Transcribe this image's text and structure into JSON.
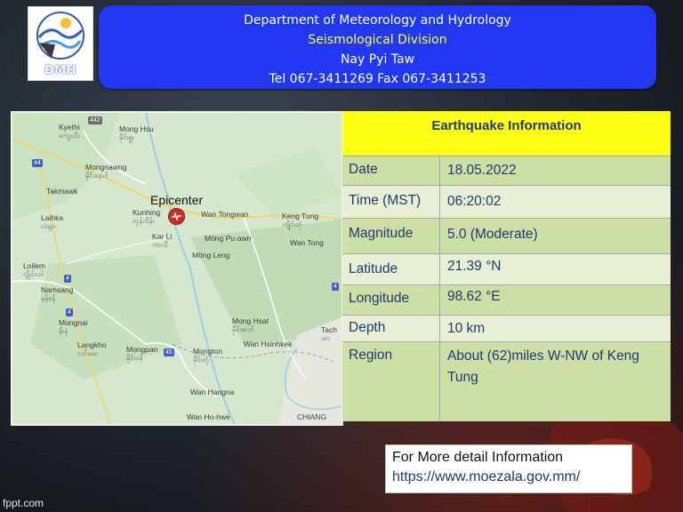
{
  "header": {
    "logo_text": "DMH",
    "line1": "Department of Meteorology and Hydrology",
    "line2": "Seismological Division",
    "line3": "Nay Pyi Taw",
    "line4": "Tel 067-3411269 Fax 067-3411253"
  },
  "map": {
    "epicenter_label": "Epicenter",
    "places": [
      {
        "name": "Kyethi",
        "sub": "ကျေးသီး"
      },
      {
        "name": "Mong Hsu",
        "sub": "မိုင်းရှူး"
      },
      {
        "name": "Mongnawng",
        "sub": "မိုင်းနောင်"
      },
      {
        "name": "Takmawk",
        "sub": ""
      },
      {
        "name": "Laihka",
        "sub": "လဲချား"
      },
      {
        "name": "Kunhing",
        "sub": "ကွန်ဟိန်း"
      },
      {
        "name": "Wan Tongwan",
        "sub": ""
      },
      {
        "name": "Keng Tung",
        "sub": "ကျိုင်းတုံ"
      },
      {
        "name": "Kar Li",
        "sub": "ကာလိ"
      },
      {
        "name": "Möng Pu-awn",
        "sub": ""
      },
      {
        "name": "Wan Tong",
        "sub": ""
      },
      {
        "name": "Möng Leng",
        "sub": ""
      },
      {
        "name": "Loilem",
        "sub": "လွိုင်လင်"
      },
      {
        "name": "Namsang",
        "sub": "နမ့်စန်"
      },
      {
        "name": "Mongnai",
        "sub": "မိုးနဲ"
      },
      {
        "name": "Mong Hsat",
        "sub": "မိုင်းဆတ်"
      },
      {
        "name": "Tach",
        "sub": "ထာ"
      },
      {
        "name": "Langkho",
        "sub": "လင်းခေး"
      },
      {
        "name": "Mongpan",
        "sub": "မိုင်းပန်"
      },
      {
        "name": "Mongton",
        "sub": "မိုင်းတုံ"
      },
      {
        "name": "Wan Hsinhkek",
        "sub": ""
      },
      {
        "name": "Wan Hangna",
        "sub": ""
      },
      {
        "name": "Wan Ho-hwe",
        "sub": ""
      },
      {
        "name": "CHIANG",
        "sub": ""
      }
    ],
    "shields": [
      "442",
      "44",
      "4",
      "4",
      "4",
      "45"
    ]
  },
  "info": {
    "title": "Earthquake Information",
    "rows": [
      {
        "label": "Date",
        "value": "18.05.2022"
      },
      {
        "label": "Time (MST)",
        "value": "06:20:02"
      },
      {
        "label": "Magnitude",
        "value": "5.0 (Moderate)"
      },
      {
        "label": "Latitude",
        "value": "21.39 °N"
      },
      {
        "label": "Longitude",
        "value": "98.62 °E"
      },
      {
        "label": "Depth",
        "value": "10 km"
      },
      {
        "label": "Region",
        "value": "About (62)miles W-NW of Keng Tung"
      }
    ]
  },
  "more_info": {
    "title": "For More detail Information",
    "url": "https://www.moezala.gov.mm/"
  },
  "footer": "fppt.com"
}
